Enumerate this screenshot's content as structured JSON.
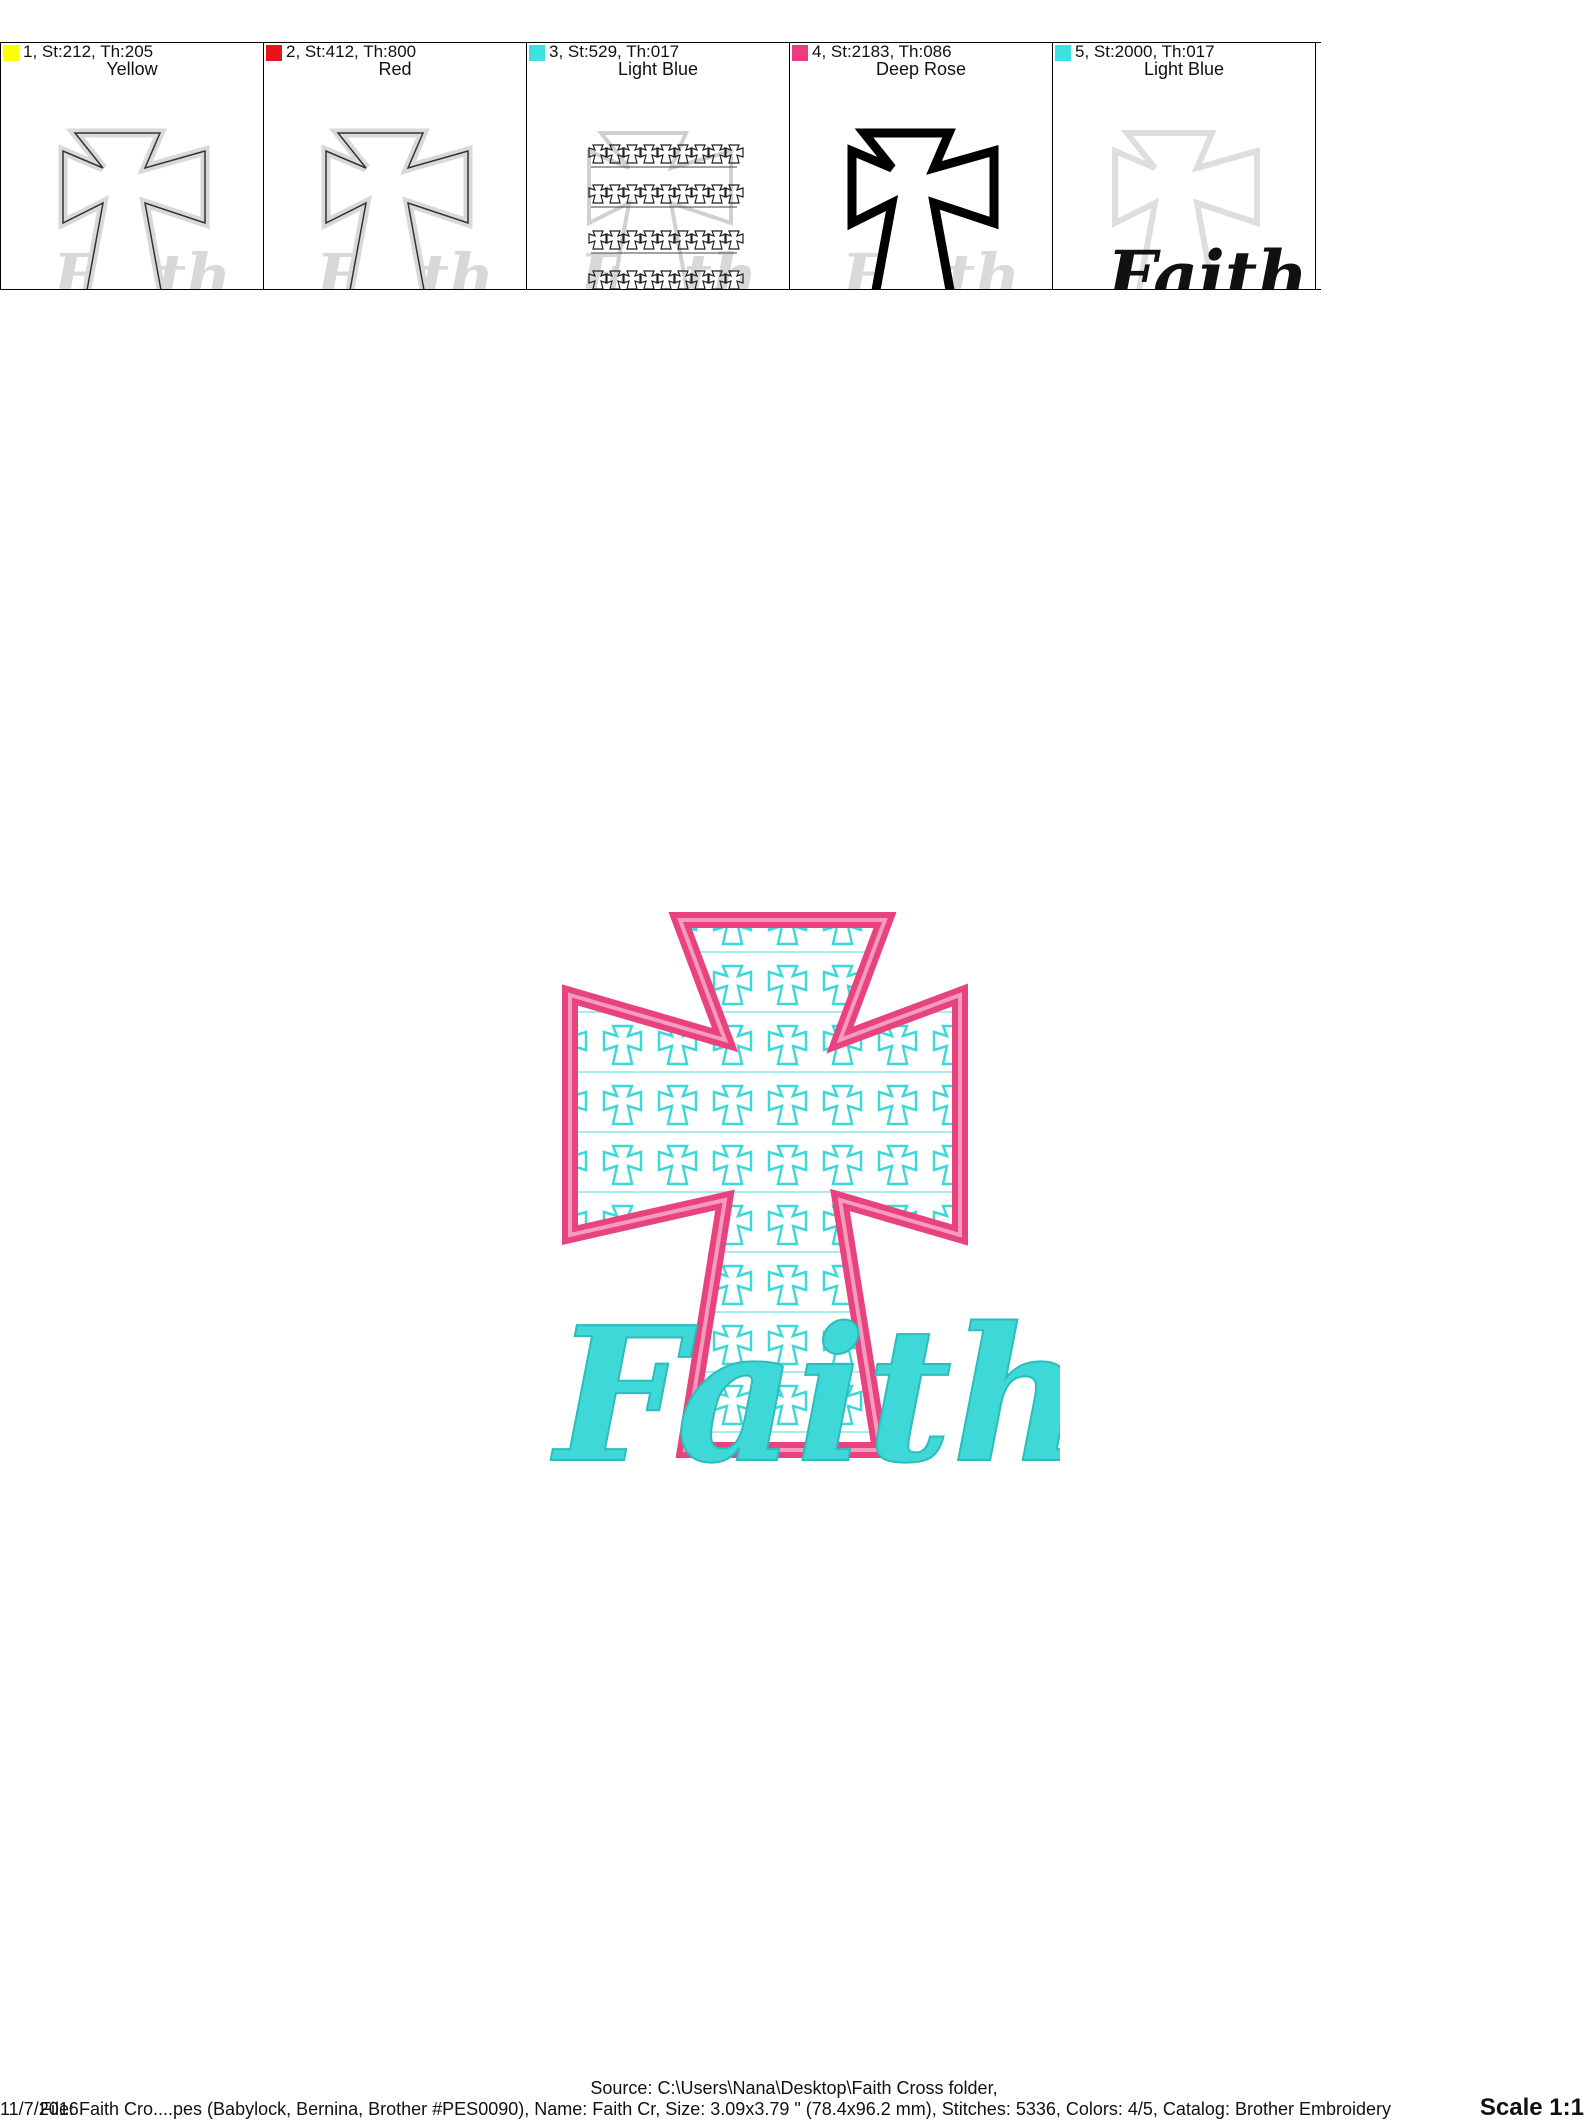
{
  "colors": {
    "yellow": "#ffff00",
    "red": "#e8141c",
    "light_blue": "#3ee0e0",
    "deep_rose": "#ee3b7d",
    "pink_stitch": "#e8437e",
    "turquoise_stitch": "#3fd8d8",
    "ghost_gray": "#cfcfcf"
  },
  "stops": [
    {
      "number": "1",
      "info": "1, St:212, Th:205",
      "name": "Yellow",
      "chip_color": "#ffff00",
      "icon": "cross-outline-icon"
    },
    {
      "number": "2",
      "info": "2, St:412, Th:800",
      "name": "Red",
      "chip_color": "#e8141c",
      "icon": "cross-outline-icon"
    },
    {
      "number": "3",
      "info": "3, St:529, Th:017",
      "name": "Light Blue",
      "chip_color": "#3ee0e0",
      "icon": "cross-pattern-icon"
    },
    {
      "number": "4",
      "info": "4, St:2183, Th:086",
      "name": "Deep Rose",
      "chip_color": "#ee3b7d",
      "icon": "cross-satin-border-icon"
    },
    {
      "number": "5",
      "info": "5, St:2000, Th:017",
      "name": "Light Blue",
      "chip_color": "#3ee0e0",
      "icon": "faith-script-icon"
    }
  ],
  "design": {
    "word": "Faith",
    "thumb_word": "Faith"
  },
  "footer": {
    "source": "Source: C:\\Users\\Nana\\Desktop\\Faith Cross folder,",
    "date": "11/7/2016",
    "file_line": "File: Faith Cro....pes (Babylock, Bernina, Brother #PES0090), Name: Faith Cr, Size: 3.09x3.79 \" (78.4x96.2 mm), Stitches: 5336, Colors: 4/5, Catalog: Brother Embroidery",
    "scale": "Scale 1:1"
  }
}
